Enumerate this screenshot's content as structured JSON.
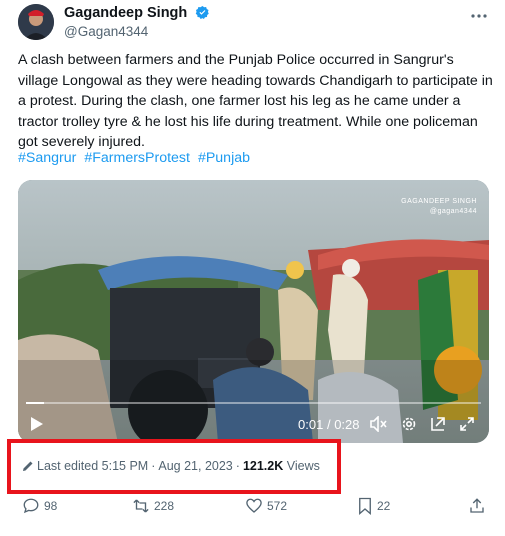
{
  "author": {
    "display_name": "Gagandeep Singh",
    "handle": "@Gagan4344"
  },
  "tweet": {
    "text": "A clash between farmers and the Punjab Police occurred in Sangrur's village Longowal as they were heading towards Chandigarh to participate in a protest. During the clash, one farmer lost his leg as he came under a tractor trolley tyre & he lost his life during treatment. While one policeman got severely injured.",
    "hashtags": [
      "#Sangrur",
      "#FarmersProtest",
      "#Punjab"
    ]
  },
  "video": {
    "watermark_name": "GAGANDEEP SINGH",
    "watermark_handle": "@gagan4344",
    "current_time": "0:01",
    "separator": "/",
    "duration": "0:28",
    "progress_fraction": 0.04
  },
  "meta": {
    "edited_label": "Last edited",
    "time": "5:15 PM",
    "separator": "·",
    "date": "Aug 21, 2023",
    "views_count": "121.2K",
    "views_label": "Views"
  },
  "actions": {
    "replies": "98",
    "reposts": "228",
    "likes": "572",
    "bookmarks": "22"
  },
  "colors": {
    "accent": "#1d9bf0",
    "highlight_border": "#e8141c",
    "muted_text": "#536471"
  }
}
